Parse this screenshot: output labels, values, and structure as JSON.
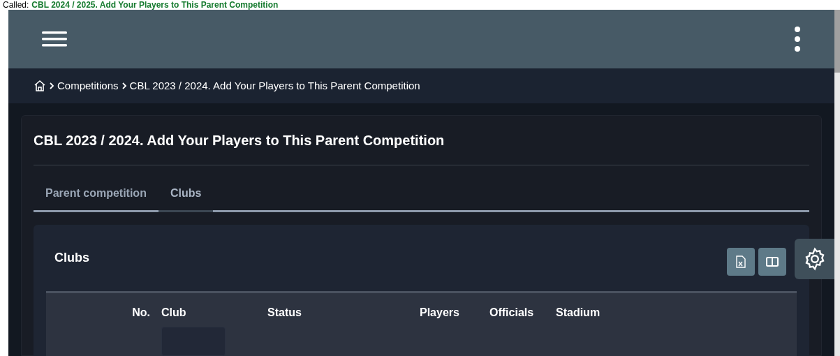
{
  "caption": {
    "label": "Called:",
    "title": "CBL 2024 / 2025. Add Your Players to This Parent Competition"
  },
  "breadcrumb": [
    "Competitions",
    "CBL 2023 / 2024. Add Your Players to This Parent Competition"
  ],
  "page_title": "CBL 2023 / 2024. Add Your Players to This Parent Competition",
  "tabs": [
    {
      "label": "Parent competition",
      "selected": false
    },
    {
      "label": "Clubs",
      "selected": true
    }
  ],
  "panel": {
    "title": "Clubs"
  },
  "table": {
    "columns": [
      "No.",
      "Club",
      "Status",
      "Players",
      "Officials",
      "Stadium"
    ]
  }
}
